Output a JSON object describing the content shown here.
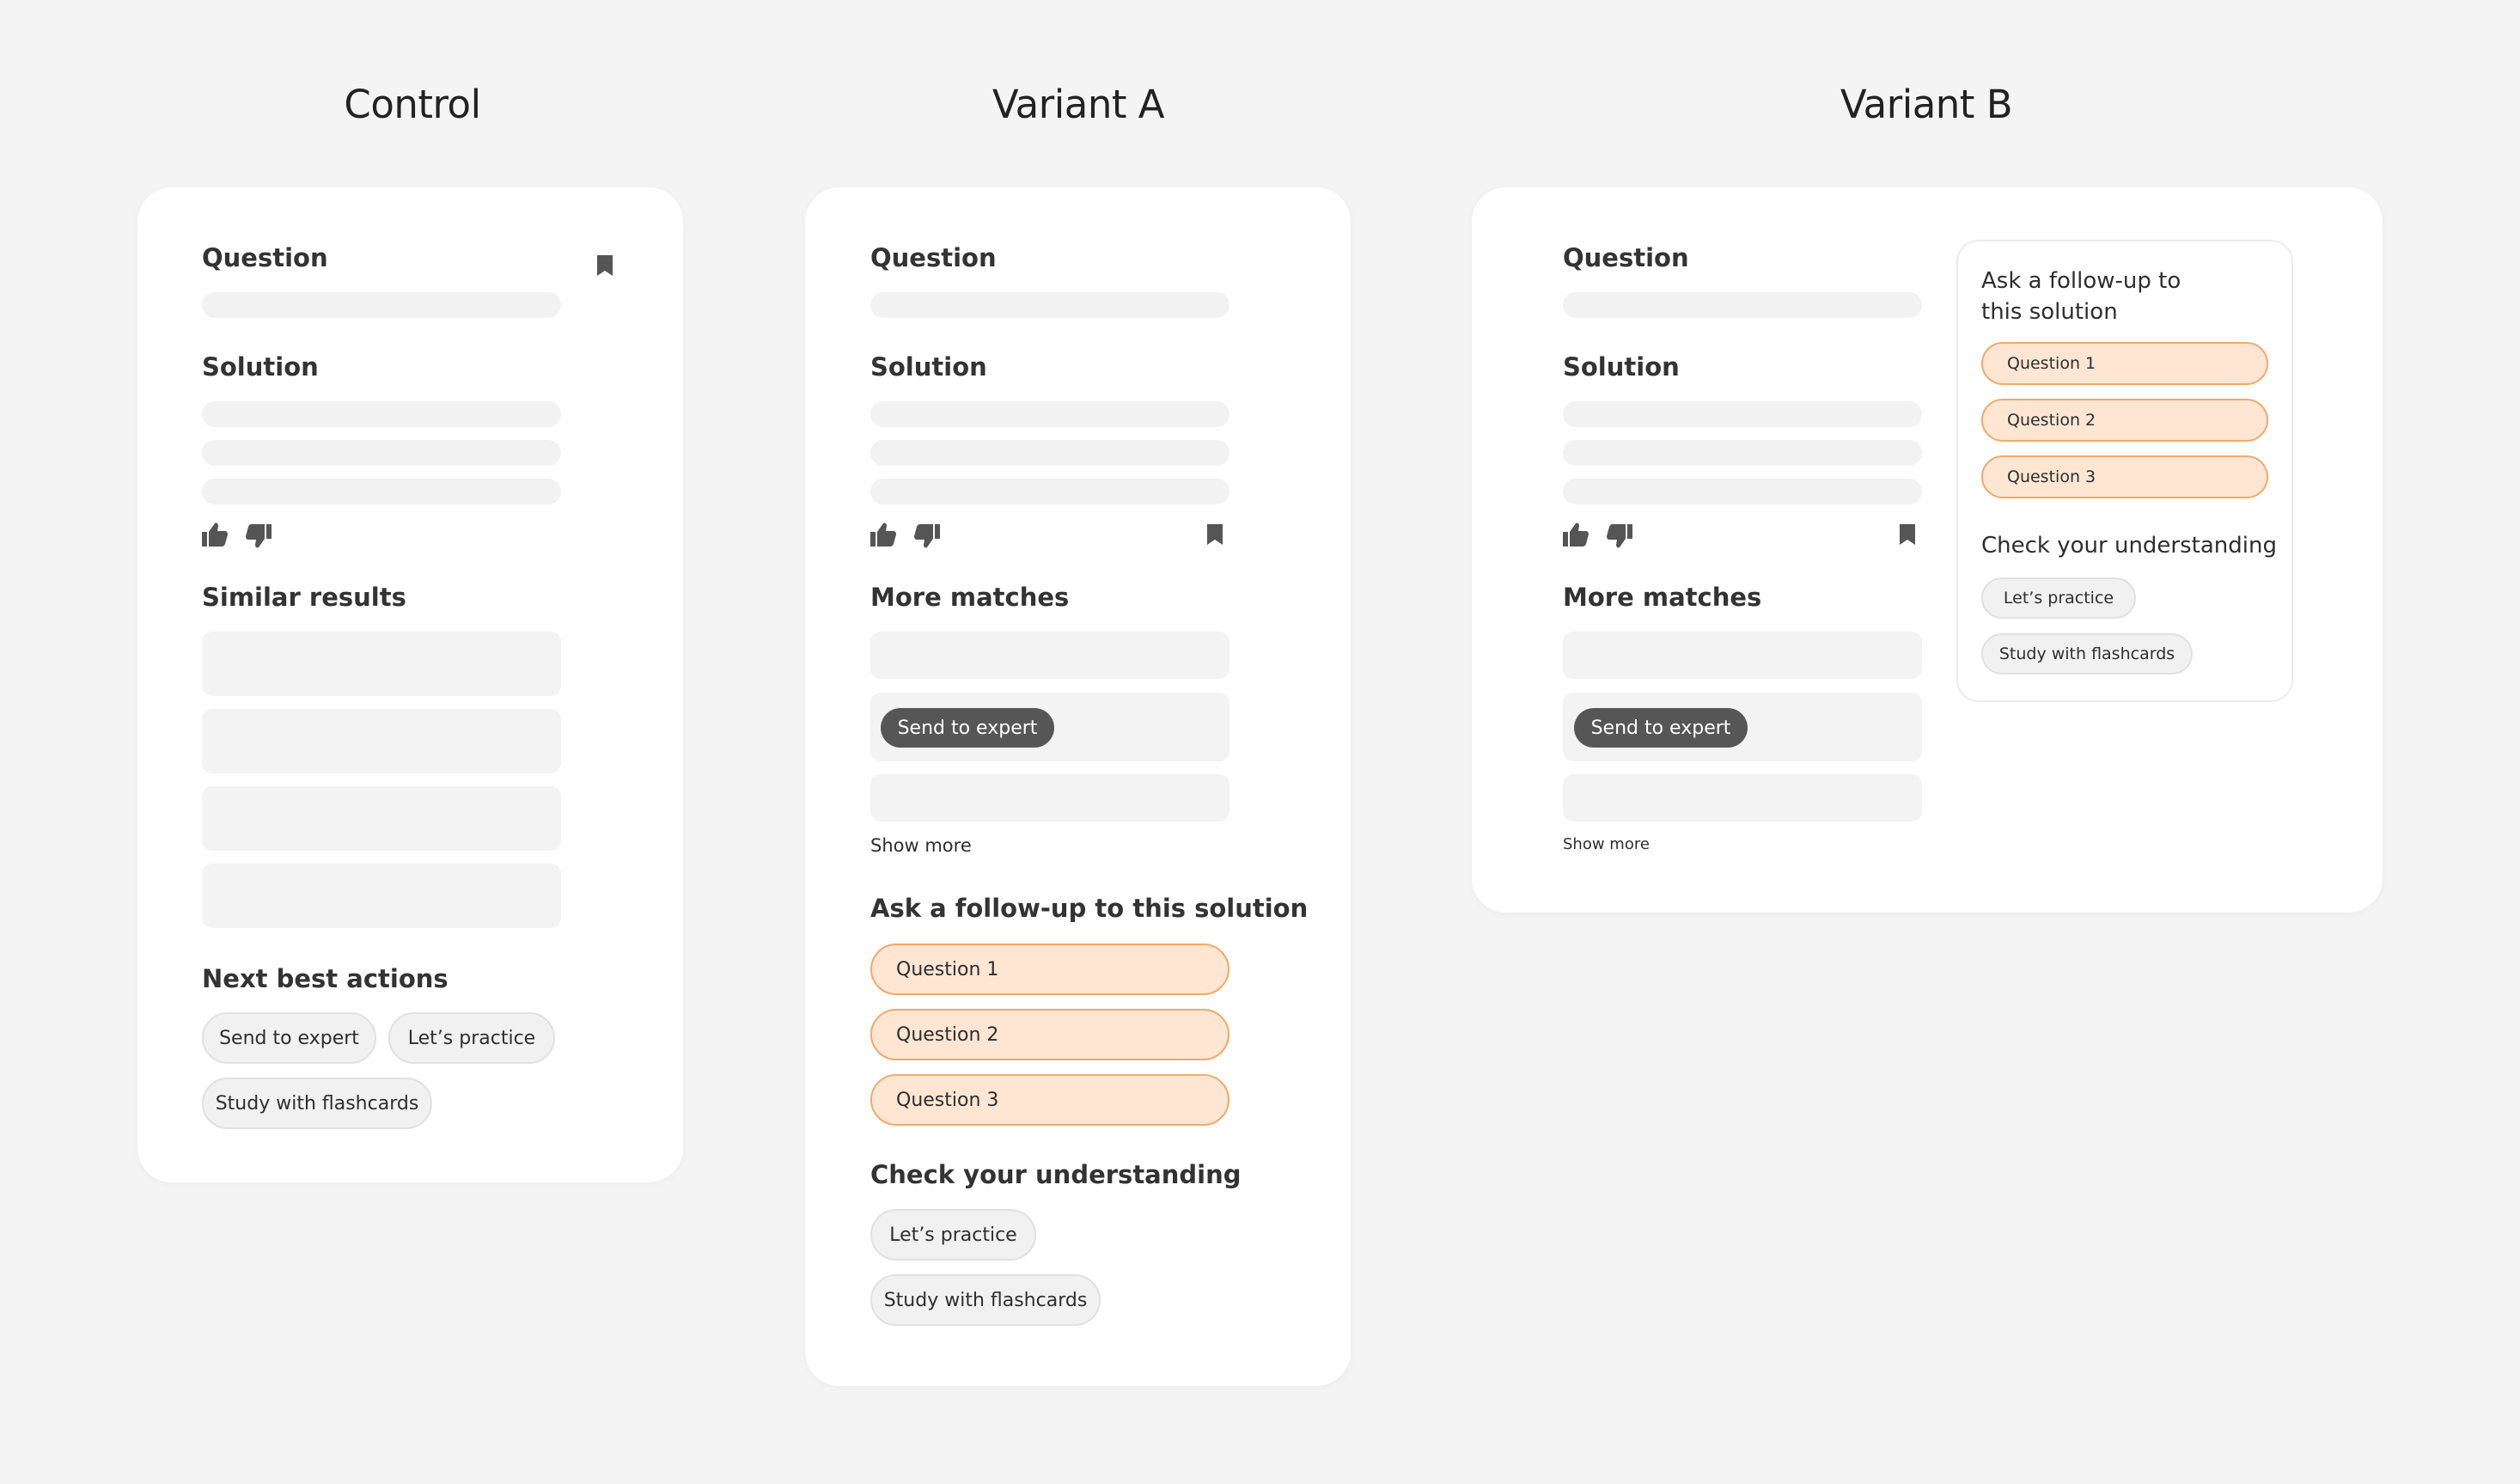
{
  "columns": {
    "control_title": "Control",
    "variant_a_title": "Variant A",
    "variant_b_title": "Variant B"
  },
  "control": {
    "question_label": "Question",
    "solution_label": "Solution",
    "similar_label": "Similar  results",
    "next_actions_label": "Next best actions",
    "actions": [
      "Send to expert",
      "Let’s practice",
      "Study with flashcards"
    ]
  },
  "variant_a": {
    "question_label": "Question",
    "solution_label": "Solution",
    "more_matches_label": "More matches",
    "send_expert_label": "Send to expert",
    "show_more_label": "Show more",
    "followup_label": "Ask a follow-up to this solution",
    "questions": [
      "Question 1",
      "Question 2",
      "Question 3"
    ],
    "check_label": "Check your understanding",
    "practice_label": "Let’s practice",
    "flashcards_label": "Study with flashcards"
  },
  "variant_b": {
    "question_label": "Question",
    "solution_label": "Solution",
    "more_matches_label": "More matches",
    "send_expert_label": "Send to expert",
    "show_more_label": "Show more",
    "followup_line1": "Ask a follow-up to",
    "followup_line2": "this solution",
    "questions": [
      "Question 1",
      "Question 2",
      "Question 3"
    ],
    "check_label": "Check your understanding",
    "practice_label": "Let’s practice",
    "flashcards_label": "Study with flashcards"
  },
  "icons": {
    "bookmark": "bookmark-icon",
    "thumbs_up": "thumbs-up-icon",
    "thumbs_down": "thumbs-down-icon"
  },
  "colors": {
    "background": "#f4f4f5",
    "card": "#ffffff",
    "placeholder": "#f2f2f3",
    "followup_fill": "#fee6d3",
    "followup_border": "#f5a868",
    "expert_button": "#565656"
  }
}
